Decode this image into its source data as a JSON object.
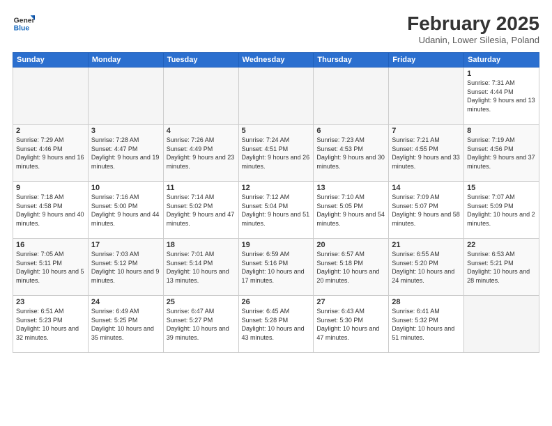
{
  "logo": {
    "line1": "General",
    "line2": "Blue"
  },
  "title": "February 2025",
  "subtitle": "Udanin, Lower Silesia, Poland",
  "headers": [
    "Sunday",
    "Monday",
    "Tuesday",
    "Wednesday",
    "Thursday",
    "Friday",
    "Saturday"
  ],
  "weeks": [
    [
      {
        "day": "",
        "info": ""
      },
      {
        "day": "",
        "info": ""
      },
      {
        "day": "",
        "info": ""
      },
      {
        "day": "",
        "info": ""
      },
      {
        "day": "",
        "info": ""
      },
      {
        "day": "",
        "info": ""
      },
      {
        "day": "1",
        "info": "Sunrise: 7:31 AM\nSunset: 4:44 PM\nDaylight: 9 hours and 13 minutes."
      }
    ],
    [
      {
        "day": "2",
        "info": "Sunrise: 7:29 AM\nSunset: 4:46 PM\nDaylight: 9 hours and 16 minutes."
      },
      {
        "day": "3",
        "info": "Sunrise: 7:28 AM\nSunset: 4:47 PM\nDaylight: 9 hours and 19 minutes."
      },
      {
        "day": "4",
        "info": "Sunrise: 7:26 AM\nSunset: 4:49 PM\nDaylight: 9 hours and 23 minutes."
      },
      {
        "day": "5",
        "info": "Sunrise: 7:24 AM\nSunset: 4:51 PM\nDaylight: 9 hours and 26 minutes."
      },
      {
        "day": "6",
        "info": "Sunrise: 7:23 AM\nSunset: 4:53 PM\nDaylight: 9 hours and 30 minutes."
      },
      {
        "day": "7",
        "info": "Sunrise: 7:21 AM\nSunset: 4:55 PM\nDaylight: 9 hours and 33 minutes."
      },
      {
        "day": "8",
        "info": "Sunrise: 7:19 AM\nSunset: 4:56 PM\nDaylight: 9 hours and 37 minutes."
      }
    ],
    [
      {
        "day": "9",
        "info": "Sunrise: 7:18 AM\nSunset: 4:58 PM\nDaylight: 9 hours and 40 minutes."
      },
      {
        "day": "10",
        "info": "Sunrise: 7:16 AM\nSunset: 5:00 PM\nDaylight: 9 hours and 44 minutes."
      },
      {
        "day": "11",
        "info": "Sunrise: 7:14 AM\nSunset: 5:02 PM\nDaylight: 9 hours and 47 minutes."
      },
      {
        "day": "12",
        "info": "Sunrise: 7:12 AM\nSunset: 5:04 PM\nDaylight: 9 hours and 51 minutes."
      },
      {
        "day": "13",
        "info": "Sunrise: 7:10 AM\nSunset: 5:05 PM\nDaylight: 9 hours and 54 minutes."
      },
      {
        "day": "14",
        "info": "Sunrise: 7:09 AM\nSunset: 5:07 PM\nDaylight: 9 hours and 58 minutes."
      },
      {
        "day": "15",
        "info": "Sunrise: 7:07 AM\nSunset: 5:09 PM\nDaylight: 10 hours and 2 minutes."
      }
    ],
    [
      {
        "day": "16",
        "info": "Sunrise: 7:05 AM\nSunset: 5:11 PM\nDaylight: 10 hours and 5 minutes."
      },
      {
        "day": "17",
        "info": "Sunrise: 7:03 AM\nSunset: 5:12 PM\nDaylight: 10 hours and 9 minutes."
      },
      {
        "day": "18",
        "info": "Sunrise: 7:01 AM\nSunset: 5:14 PM\nDaylight: 10 hours and 13 minutes."
      },
      {
        "day": "19",
        "info": "Sunrise: 6:59 AM\nSunset: 5:16 PM\nDaylight: 10 hours and 17 minutes."
      },
      {
        "day": "20",
        "info": "Sunrise: 6:57 AM\nSunset: 5:18 PM\nDaylight: 10 hours and 20 minutes."
      },
      {
        "day": "21",
        "info": "Sunrise: 6:55 AM\nSunset: 5:20 PM\nDaylight: 10 hours and 24 minutes."
      },
      {
        "day": "22",
        "info": "Sunrise: 6:53 AM\nSunset: 5:21 PM\nDaylight: 10 hours and 28 minutes."
      }
    ],
    [
      {
        "day": "23",
        "info": "Sunrise: 6:51 AM\nSunset: 5:23 PM\nDaylight: 10 hours and 32 minutes."
      },
      {
        "day": "24",
        "info": "Sunrise: 6:49 AM\nSunset: 5:25 PM\nDaylight: 10 hours and 35 minutes."
      },
      {
        "day": "25",
        "info": "Sunrise: 6:47 AM\nSunset: 5:27 PM\nDaylight: 10 hours and 39 minutes."
      },
      {
        "day": "26",
        "info": "Sunrise: 6:45 AM\nSunset: 5:28 PM\nDaylight: 10 hours and 43 minutes."
      },
      {
        "day": "27",
        "info": "Sunrise: 6:43 AM\nSunset: 5:30 PM\nDaylight: 10 hours and 47 minutes."
      },
      {
        "day": "28",
        "info": "Sunrise: 6:41 AM\nSunset: 5:32 PM\nDaylight: 10 hours and 51 minutes."
      },
      {
        "day": "",
        "info": ""
      }
    ]
  ]
}
